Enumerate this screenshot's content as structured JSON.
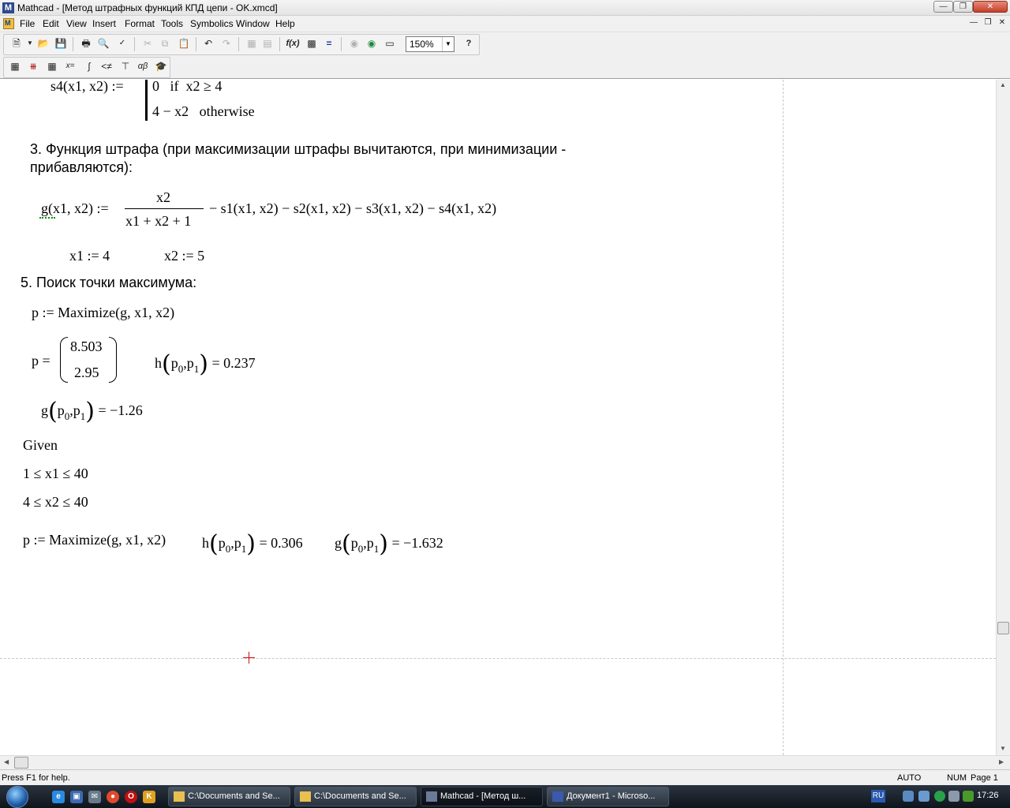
{
  "window": {
    "title": "Mathcad - [Метод штрафных функций КПД цепи - OK.xmcd]",
    "app_icon_letter": "M"
  },
  "menu": {
    "items": [
      "File",
      "Edit",
      "View",
      "Insert",
      "Format",
      "Tools",
      "Symbolics",
      "Window",
      "Help"
    ]
  },
  "toolbar": {
    "zoom": "150%"
  },
  "worksheet": {
    "s4_def": {
      "lhs": "s4(x1, x2) :=",
      "case1": "0   if  x2 ≥ 4",
      "case2": "4 − x2   otherwise"
    },
    "heading3_line1": "3. Функция штрафа (при максимизации штрафы вычитаются, при минимизации -",
    "heading3_line2": "прибавляются):",
    "g_def": {
      "lhs": "g(x1, x2) :=",
      "numerator": "x2",
      "denominator": "x1 + x2 + 1",
      "rest": "− s1(x1, x2) − s2(x1, x2) − s3(x1, x2) − s4(x1, x2)"
    },
    "x1_assign": "x1 := 4",
    "x2_assign": "x2 := 5",
    "heading5": "5. Поиск точки максимума:",
    "maximize1": "p := Maximize(g, x1, x2)",
    "p_eq": "p =",
    "p_values": [
      "8.503",
      "2.95"
    ],
    "h_result1": {
      "fn": "h",
      "arg0": "p",
      "sub0": "0",
      "arg1": "p",
      "sub1": "1",
      "value": "= 0.237"
    },
    "g_result1": {
      "fn": "g",
      "arg0": "p",
      "sub0": "0",
      "arg1": "p",
      "sub1": "1",
      "value": "= −1.26"
    },
    "given": "Given",
    "constraint1": "1 ≤ x1 ≤ 40",
    "constraint2": "4 ≤ x2 ≤ 40",
    "maximize2": "p := Maximize(g, x1, x2)",
    "h_result2": {
      "fn": "h",
      "arg0": "p",
      "sub0": "0",
      "arg1": "p",
      "sub1": "1",
      "value": "= 0.306"
    },
    "g_result2": {
      "fn": "g",
      "arg0": "p",
      "sub0": "0",
      "arg1": "p",
      "sub1": "1",
      "value": "= −1.632"
    }
  },
  "statusbar": {
    "help": "Press F1 for help.",
    "mode": "AUTO",
    "num": "NUM",
    "page": "Page 1"
  },
  "taskbar": {
    "buttons": [
      "C:\\Documents and Se...",
      "C:\\Documents and Se...",
      "Mathcad - [Метод ш...",
      "Документ1 - Microso..."
    ],
    "lang": "RU",
    "clock": "17:26"
  }
}
